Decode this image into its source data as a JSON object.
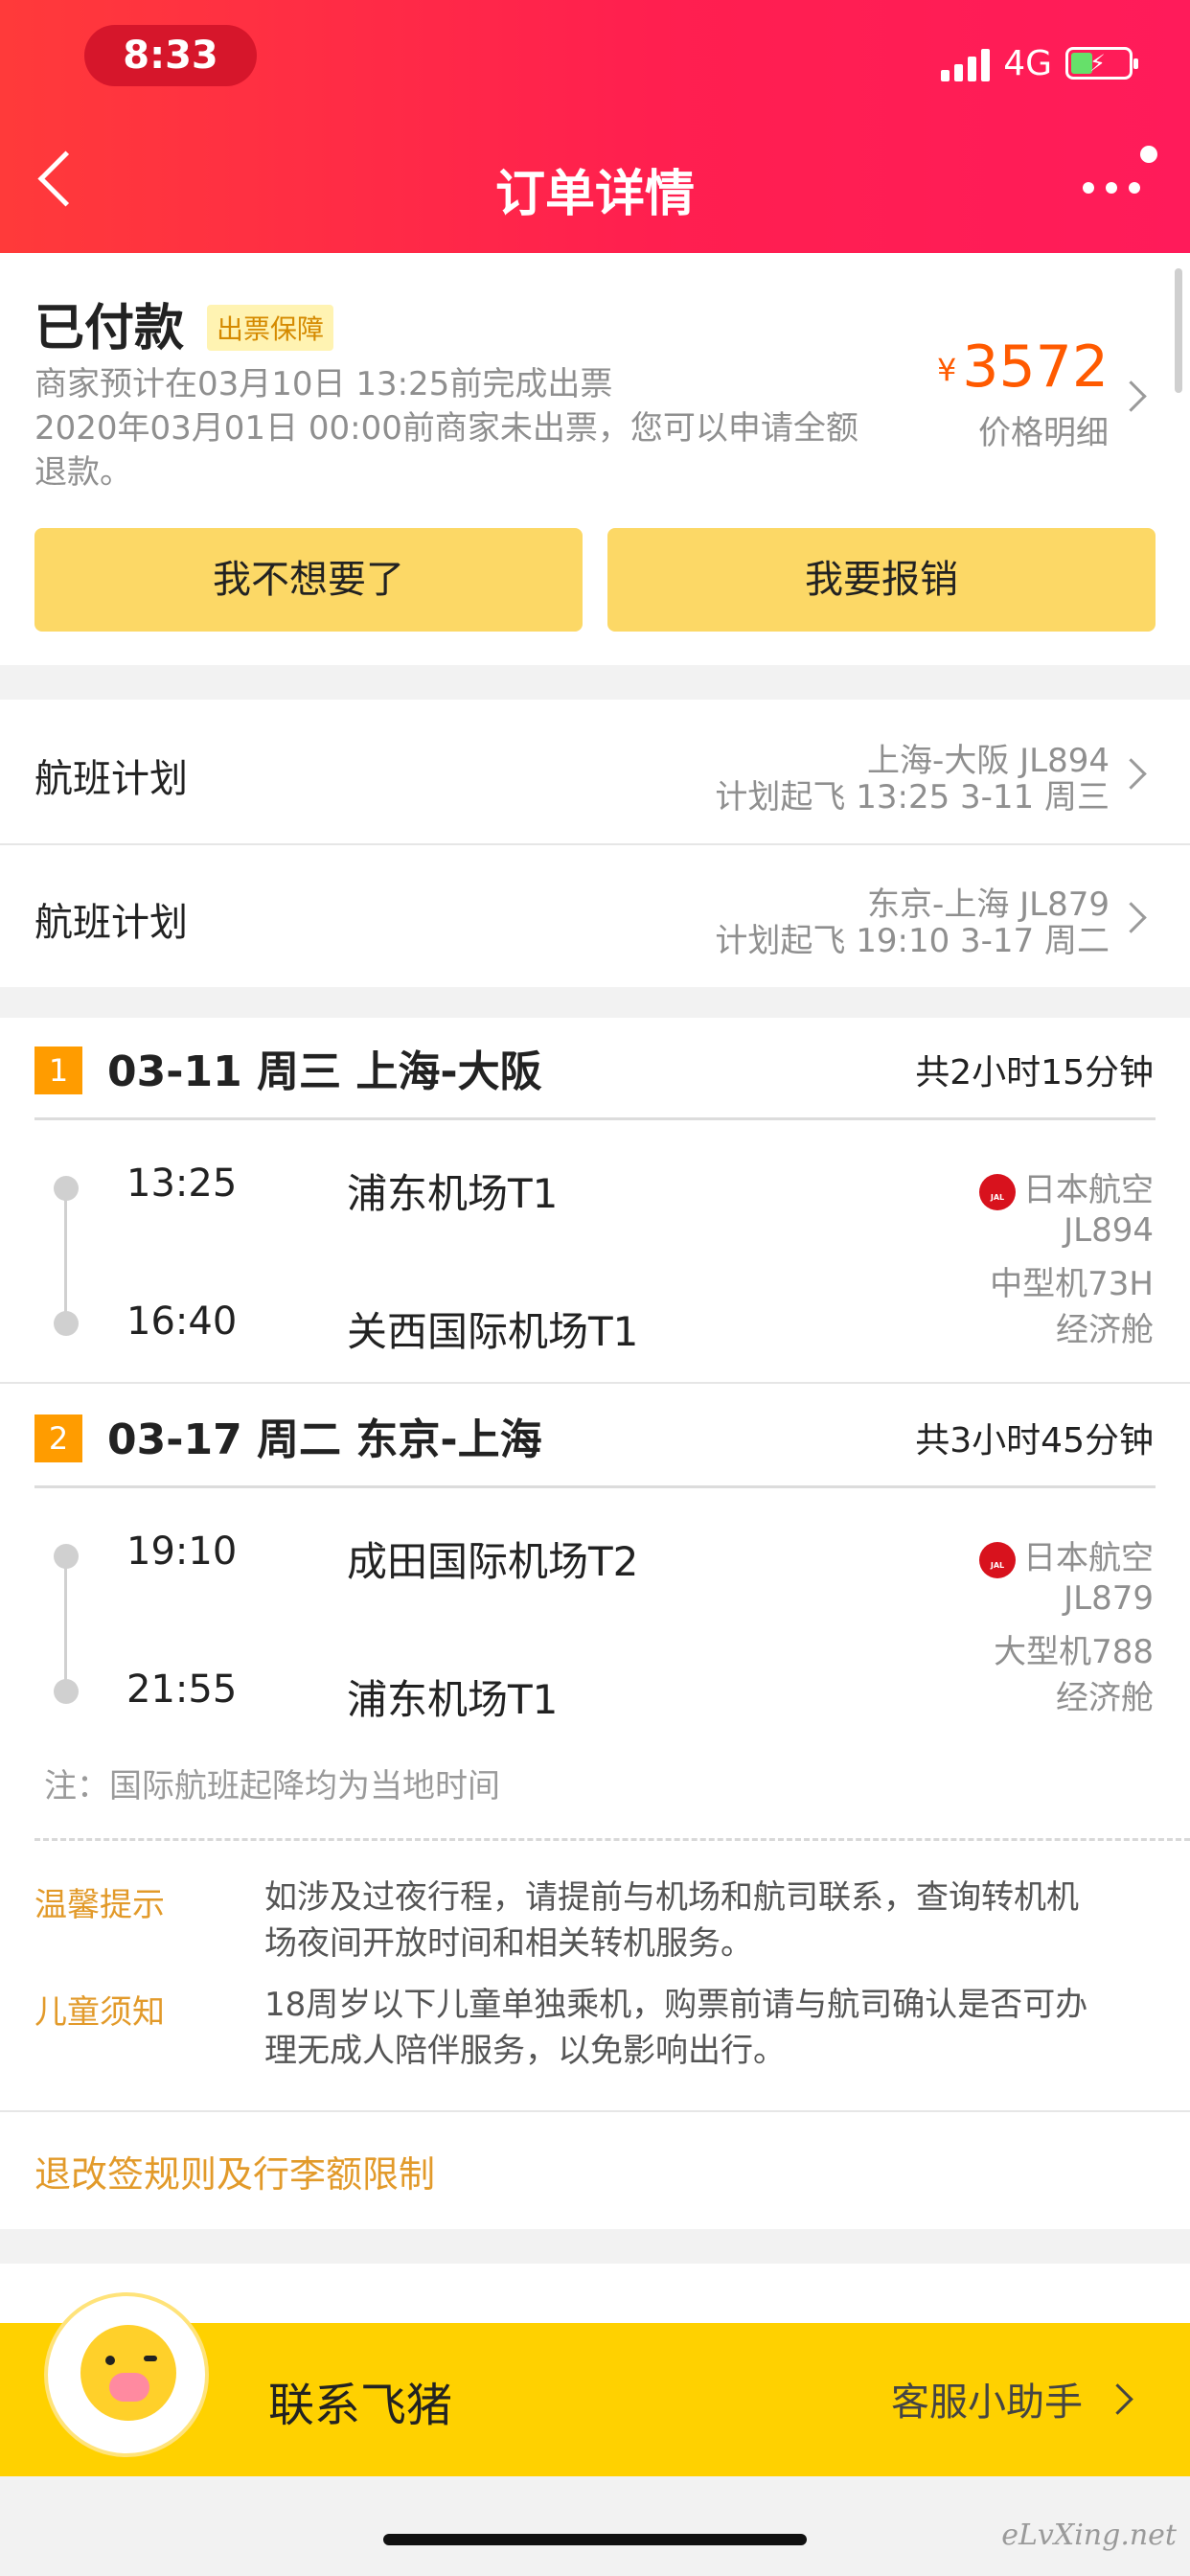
{
  "status_bar": {
    "time": "8:33",
    "network": "4G"
  },
  "nav": {
    "title": "订单详情"
  },
  "order": {
    "status": "已付款",
    "badge": "出票保障",
    "desc_line1": "商家预计在03月10日 13:25前完成出票",
    "desc_line2": "2020年03月01日 00:00前商家未出票，您可以申请全额",
    "desc_line3": "退款。",
    "price_symbol": "¥",
    "price": "3572",
    "price_label": "价格明细",
    "btn_cancel": "我不想要了",
    "btn_reimburse": "我要报销"
  },
  "plans": [
    {
      "label": "航班计划",
      "route": "上海-大阪 JL894",
      "sched": "计划起飞 13:25 3-11 周三"
    },
    {
      "label": "航班计划",
      "route": "东京-上海 JL879",
      "sched": "计划起飞 19:10 3-17 周二"
    }
  ],
  "segments": [
    {
      "num": "1",
      "header": "03-11 周三 上海-大阪",
      "duration": "共2小时15分钟",
      "dep_time": "13:25",
      "dep_port": "浦东机场T1",
      "arr_time": "16:40",
      "arr_port": "关西国际机场T1",
      "airline": "日本航空",
      "flight_no": "JL894",
      "aircraft": "中型机73H",
      "cabin": "经济舱"
    },
    {
      "num": "2",
      "header": "03-17 周二 东京-上海",
      "duration": "共3小时45分钟",
      "dep_time": "19:10",
      "dep_port": "成田国际机场T2",
      "arr_time": "21:55",
      "arr_port": "浦东机场T1",
      "airline": "日本航空",
      "flight_no": "JL879",
      "aircraft": "大型机788",
      "cabin": "经济舱"
    }
  ],
  "note": "注：国际航班起降均为当地时间",
  "tips": [
    {
      "label": "温馨提示",
      "line1": "如涉及过夜行程，请提前与机场和航司联系，查询转机机",
      "line2": "场夜间开放时间和相关转机服务。"
    },
    {
      "label": "儿童须知",
      "line1": "18周岁以下儿童单独乘机，购票前请与航司确认是否可办",
      "line2": "理无成人陪伴服务，以免影响出行。"
    }
  ],
  "rules_link": "退改签规则及行李额限制",
  "bottom": {
    "contact": "联系飞猪",
    "cs": "客服小助手"
  },
  "watermark": "eLvXing.net",
  "colors": {
    "header": "#ff1f4f",
    "accent_yellow": "#fcd866",
    "price": "#ff5a00",
    "bottom_bar": "#ffd100"
  }
}
